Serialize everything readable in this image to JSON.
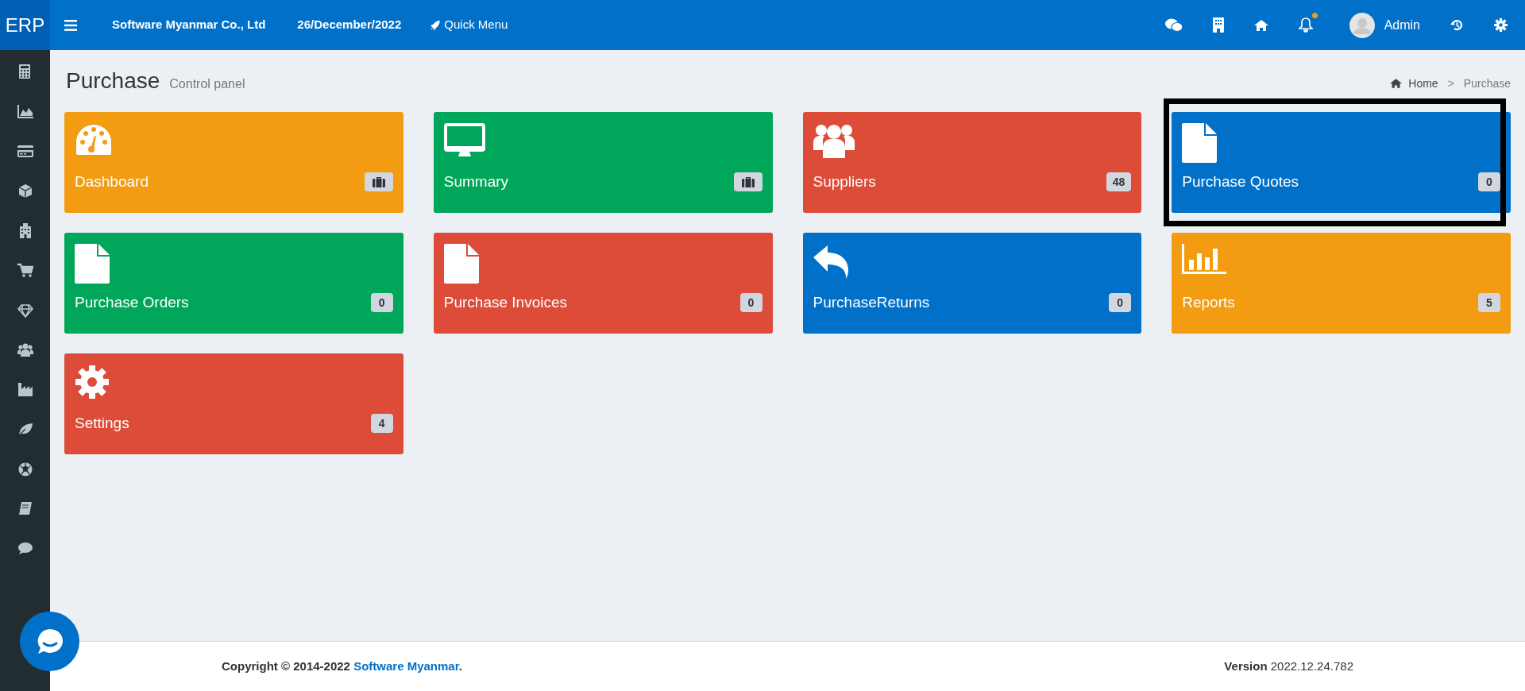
{
  "topbar": {
    "logo": "ERP",
    "company": "Software Myanmar Co., Ltd",
    "date": "26/December/2022",
    "quick_menu": "Quick Menu",
    "user": "Admin",
    "notification_dot": true
  },
  "page": {
    "title": "Purchase",
    "subtitle": "Control panel"
  },
  "breadcrumb": [
    {
      "label": "Home",
      "selected": false
    },
    {
      "separator": ">",
      "label": "Purchase",
      "selected": true
    }
  ],
  "tiles": [
    {
      "label": "Dashboard",
      "kind": "icon",
      "color": "#f39c12",
      "highlighted": false
    },
    {
      "label": "Summary",
      "kind": "icon",
      "color": "#00a65a",
      "highlighted": false
    },
    {
      "label": "Suppliers",
      "kind": "count",
      "count": "48",
      "color": "#dd4b39",
      "highlighted": false
    },
    {
      "label": "Purchase Quotes",
      "kind": "count",
      "count": "0",
      "color": "#0070c9",
      "highlighted": true
    },
    {
      "label": "Purchase Orders",
      "kind": "count",
      "count": "0",
      "color": "#00a65a",
      "highlighted": false
    },
    {
      "label": "Purchase Invoices",
      "kind": "count",
      "count": "0",
      "color": "#dd4b39",
      "highlighted": false
    },
    {
      "label": "PurchaseReturns",
      "kind": "count",
      "count": "0",
      "color": "#0070c9",
      "highlighted": false
    },
    {
      "label": "Reports",
      "kind": "count",
      "count": "5",
      "color": "#f39c12",
      "highlighted": false
    },
    {
      "label": "Settings",
      "kind": "count",
      "count": "4",
      "color": "#dd4b39",
      "highlighted": false
    }
  ],
  "footer": {
    "copyright": "Copyright © 2014-2022 ",
    "link": "Software Myanmar",
    "period": ".",
    "version_label": "Version",
    "version": "2022.12.24.782"
  }
}
